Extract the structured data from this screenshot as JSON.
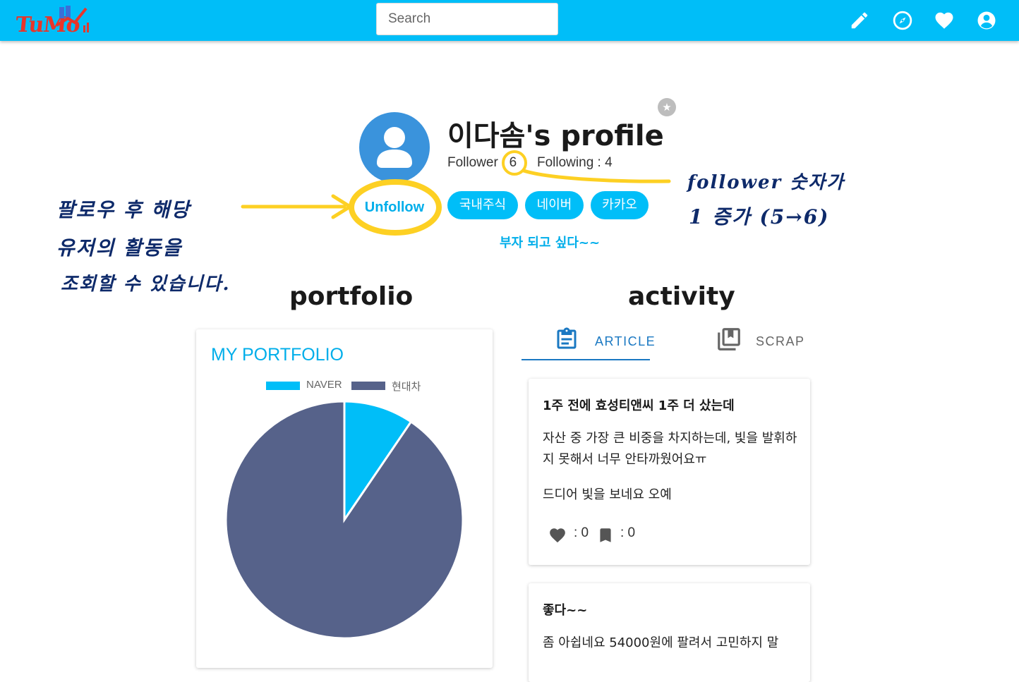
{
  "header": {
    "logo_text": "TuMo",
    "search_placeholder": "Search",
    "icons": [
      "pencil-icon",
      "compass-icon",
      "heart-icon",
      "account-icon"
    ]
  },
  "profile": {
    "name": "이다솜's profile",
    "follower_text": "Follower : 6",
    "following_text": "Following : 4",
    "follow_button_label": "Unfollow",
    "tags": [
      "국내주식",
      "네이버",
      "카카오"
    ],
    "bio": "부자 되고 싶다~~"
  },
  "annotations": {
    "left_note": [
      "팔로우 후 해당",
      "유저의 활동을",
      "조회할 수 있습니다."
    ],
    "right_note": [
      "follower 숫자가",
      "1 증가 (5→6)"
    ]
  },
  "sections": {
    "portfolio_title": "portfolio",
    "activity_title": "activity"
  },
  "portfolio": {
    "card_title": "MY PORTFOLIO"
  },
  "chart_data": {
    "type": "pie",
    "title": "",
    "categories": [
      "NAVER",
      "현대차"
    ],
    "values": [
      9.5,
      90.5
    ],
    "colors": [
      "#00bef8",
      "#56628a"
    ],
    "legend_placement": "top"
  },
  "tabs": [
    {
      "label": "ARTICLE",
      "icon": "clipboard-icon",
      "active": true
    },
    {
      "label": "SCRAP",
      "icon": "bookmarks-icon",
      "active": false
    }
  ],
  "articles": [
    {
      "title": "1주 전에 효성티앤씨 1주 더 샀는데",
      "paragraphs": [
        "자산 중 가장 큰 비중을 차지하는데, 빛을 발휘하지 못해서 너무 안타까웠어요ㅠ",
        "드디어 빛을 보네요 오예"
      ],
      "likes_text": ": 0",
      "scraps_text": ": 0"
    },
    {
      "title": "좋다~~",
      "paragraphs": [
        "좀 아쉽네요 54000원에 팔려서 고민하지 말"
      ]
    }
  ],
  "colors": {
    "header_bg": "#00bef8",
    "accent": "#00aeea",
    "tab_active": "#1a78c2",
    "annotation_yellow": "#fdd023",
    "annotation_ink": "#0e2a6a"
  }
}
